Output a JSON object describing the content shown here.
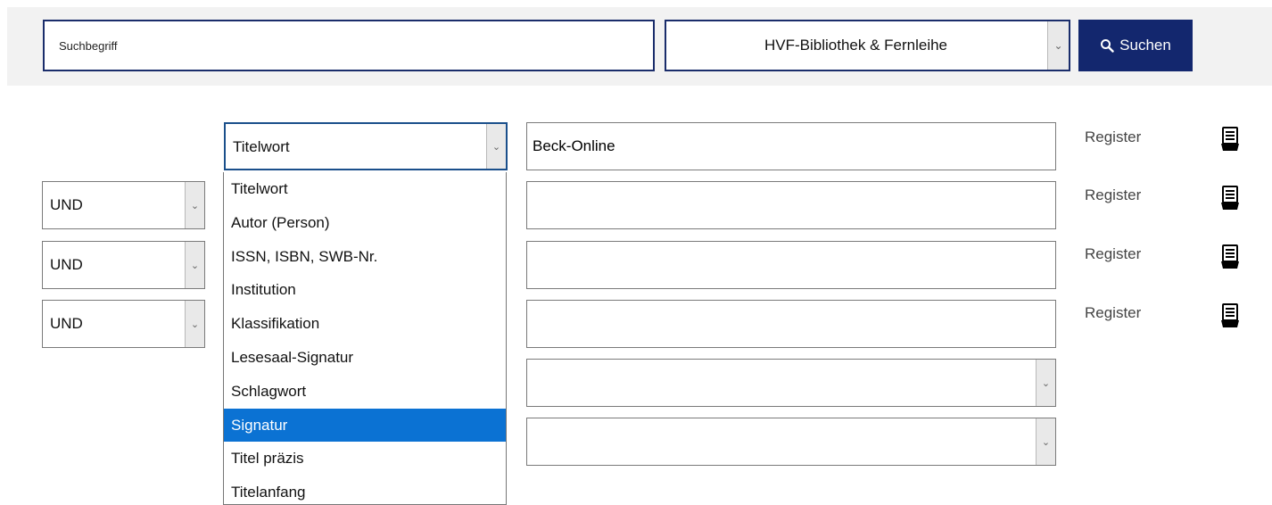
{
  "search": {
    "placeholder": "Suchbegriff",
    "catalog_value": "HVF-Bibliothek & Fernleihe",
    "button_label": "Suchen"
  },
  "advanced": {
    "rows": [
      {
        "operator": "",
        "field": "Titelwort",
        "value": "Beck-Online",
        "register": "Register"
      },
      {
        "operator": "UND",
        "field": "",
        "value": "",
        "register": "Register"
      },
      {
        "operator": "UND",
        "field": "",
        "value": "",
        "register": "Register"
      },
      {
        "operator": "UND",
        "field": "",
        "value": "",
        "register": "Register"
      }
    ],
    "filter_selects": [
      "",
      ""
    ]
  },
  "dropdown": {
    "options": [
      "Titelwort",
      "Autor (Person)",
      "ISSN, ISBN, SWB-Nr.",
      "Institution",
      "Klassifikation",
      "Lesesaal-Signatur",
      "Schlagwort",
      "Signatur",
      "Titel präzis",
      "Titelanfang"
    ],
    "highlighted": "Signatur"
  },
  "colors": {
    "accent": "#13276e",
    "border_focus": "#1a4f8b",
    "highlight": "#0b72d3"
  },
  "icons": {
    "search": "magnifier-icon",
    "register": "card-index-icon"
  }
}
